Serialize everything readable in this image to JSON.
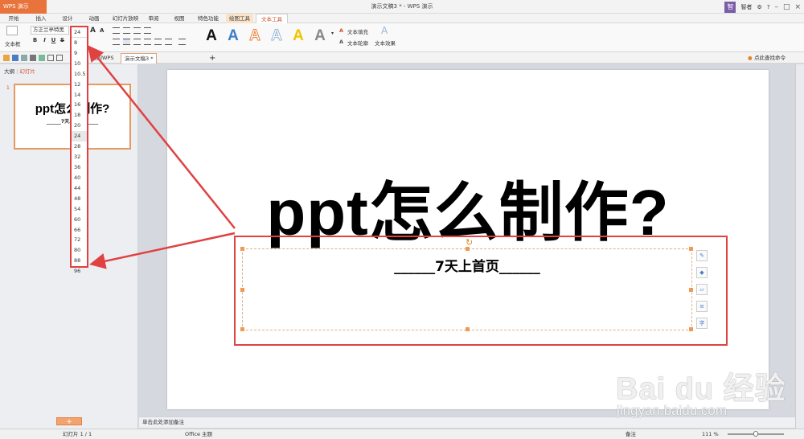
{
  "titlebar": {
    "app_button": "WPS 演示",
    "title": "演示文稿3 * - WPS 演示",
    "user": "智者",
    "avatar_char": "智",
    "controls": [
      "–",
      "□",
      "×"
    ]
  },
  "tabs": [
    "开始",
    "插入",
    "设计",
    "动画",
    "幻灯片放映",
    "审阅",
    "视图",
    "特色功能",
    "绘图工具",
    "文本工具"
  ],
  "ribbon": {
    "textbox_label": "文本框",
    "font_name": "方正兰亭特黑",
    "font_size": "24",
    "format_buttons": [
      "B",
      "I",
      "U",
      "S"
    ],
    "increase_font": "A",
    "decrease_font": "A",
    "text_fill": "文本填充",
    "text_outline": "文本轮廓",
    "text_effect": "文本效果",
    "wordart_letter": "A",
    "wordart_colors": [
      "#111111",
      "#3b7fc6",
      "#e8843e",
      "#9ab6d4",
      "#f2c400",
      "#888888"
    ],
    "accent": "#d0522a"
  },
  "qat": {
    "doc_tabs": [
      "我的WPS",
      "演示文稿3 *"
    ],
    "add_tab": "+",
    "search_hint": "点此查找命令 (Alt+Q)"
  },
  "panel": {
    "tab_outline": "大纲",
    "tab_slides": "幻灯片",
    "slide_number": "1",
    "thumb_title": "ppt怎么制作?",
    "thumb_sub": "______7天上首页______",
    "add_button": "+"
  },
  "slide": {
    "title": "ppt怎么制作?",
    "subtitle": "______7天上首页______"
  },
  "notes_placeholder": "单击此处添加备注",
  "status": {
    "slide_count": "幻灯片 1 / 1",
    "theme": "Office 主题",
    "notes_btn": "备注",
    "zoom": "111 %"
  },
  "font_sizes": [
    "8",
    "9",
    "10",
    "10.5",
    "12",
    "14",
    "16",
    "18",
    "20",
    "24",
    "28",
    "32",
    "36",
    "40",
    "44",
    "48",
    "54",
    "60",
    "66",
    "72",
    "80",
    "88",
    "96"
  ],
  "selected_font_size": "24",
  "watermark": {
    "logo": "Bai du 经验",
    "url": "jingyan.baidu.com"
  }
}
